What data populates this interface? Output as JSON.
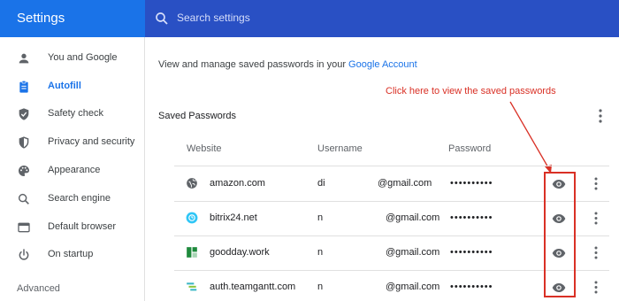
{
  "header": {
    "app_title": "Settings",
    "search_placeholder": "Search settings"
  },
  "sidebar": {
    "items": [
      {
        "label": "You and Google",
        "icon": "person-icon",
        "active": false
      },
      {
        "label": "Autofill",
        "icon": "clipboard-icon",
        "active": true
      },
      {
        "label": "Safety check",
        "icon": "shield-check-icon",
        "active": false
      },
      {
        "label": "Privacy and security",
        "icon": "shield-icon",
        "active": false
      },
      {
        "label": "Appearance",
        "icon": "palette-icon",
        "active": false
      },
      {
        "label": "Search engine",
        "icon": "search-icon",
        "active": false
      },
      {
        "label": "Default browser",
        "icon": "browser-icon",
        "active": false
      },
      {
        "label": "On startup",
        "icon": "power-icon",
        "active": false
      }
    ],
    "advanced_label": "Advanced"
  },
  "main": {
    "intro_text": "View and manage saved passwords in your ",
    "intro_link": "Google Account",
    "annotation": "Click here to view the saved passwords",
    "section_title": "Saved Passwords",
    "columns": {
      "website": "Website",
      "username": "Username",
      "password": "Password"
    },
    "rows": [
      {
        "site": "amazon.com",
        "user": "di",
        "domain": "@gmail.com",
        "password": "••••••••••",
        "icon": "globe-icon"
      },
      {
        "site": "bitrix24.net",
        "user": "n",
        "domain": "@gmail.com",
        "password": "••••••••••",
        "icon": "bitrix-icon"
      },
      {
        "site": "goodday.work",
        "user": "n",
        "domain": "@gmail.com",
        "password": "••••••••••",
        "icon": "goodday-icon"
      },
      {
        "site": "auth.teamgantt.com",
        "user": "n",
        "domain": "@gmail.com",
        "password": "••••••••••",
        "icon": "teamgantt-icon"
      }
    ]
  },
  "colors": {
    "accent": "#1a73e8",
    "header_bg": "#2f4fc0",
    "annotation": "#d93025"
  }
}
